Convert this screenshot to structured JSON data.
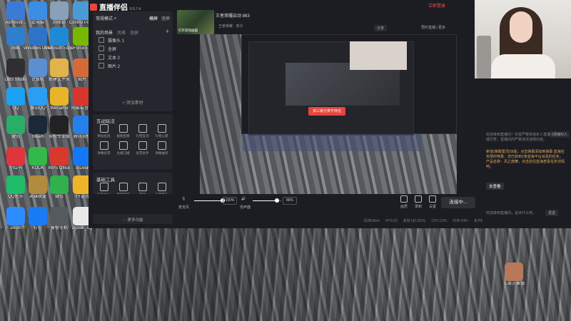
{
  "desktop": {
    "icons": [
      {
        "label": "Administr...",
        "color": "#3b7bd5"
      },
      {
        "label": "此电脑",
        "color": "#3a8ee6"
      },
      {
        "label": "回收站",
        "color": "#8aa0b8"
      },
      {
        "label": "Control Panel",
        "color": "#4a9ad6"
      },
      {
        "label": "网络",
        "color": "#2f7fcf"
      },
      {
        "label": "Windows Defender",
        "color": "#2d74c7"
      },
      {
        "label": "Microsoft Edge",
        "color": "#1e8ad6"
      },
      {
        "label": "GeForce Experience",
        "color": "#76b900"
      },
      {
        "label": "OBS Studio",
        "color": "#302e31"
      },
      {
        "label": "计算机",
        "color": "#5b8fd1"
      },
      {
        "label": "新建文件夹",
        "color": "#e0b44a"
      },
      {
        "label": "图片",
        "color": "#d46a3a"
      },
      {
        "label": "QQ",
        "color": "#1da1f2"
      },
      {
        "label": "腾讯QQ",
        "color": "#2a9df4"
      },
      {
        "label": "WeGame",
        "color": "#e8b52a"
      },
      {
        "label": "网易云音乐",
        "color": "#d8362d"
      },
      {
        "label": "微信",
        "color": "#2aae67"
      },
      {
        "label": "Steam",
        "color": "#1b2838"
      },
      {
        "label": "剪映专业版",
        "color": "#222222"
      },
      {
        "label": "腾讯视频",
        "color": "#2680eb"
      },
      {
        "label": "小红书",
        "color": "#e0353a"
      },
      {
        "label": "KOOK",
        "color": "#33b84a"
      },
      {
        "label": "WPS Office",
        "color": "#d9382d"
      },
      {
        "label": "ToDesk",
        "color": "#1477f8"
      },
      {
        "label": "QQ音乐",
        "color": "#1fbd6a"
      },
      {
        "label": "英雄联盟",
        "color": "#b38b3c"
      },
      {
        "label": "微信",
        "color": "#31b04e"
      },
      {
        "label": "YY语音",
        "color": "#f0b42a"
      },
      {
        "label": "Zoom",
        "color": "#2d8cff"
      },
      {
        "label": "钉钉",
        "color": "#1a7cf5"
      },
      {
        "label": "备份手机",
        "color": "#555a60"
      },
      {
        "label": "2gsldk_log",
        "color": "#e9e9e9"
      }
    ],
    "right_icon": {
      "label": "三周万象镇",
      "color": "#b8785a"
    }
  },
  "app": {
    "title": "直播伴侣",
    "version": "6.5.7.4",
    "login": "立即登录",
    "mode_select": "常规模式 ˅",
    "mode_tabs": [
      "横屏",
      "竖屏"
    ],
    "scene_tabs": [
      "我的场景",
      "风格",
      "竖屏"
    ],
    "sources": [
      "摄像头 1",
      "全屏",
      "文本 2",
      "图片 2"
    ],
    "add_material": "+ 添加素材",
    "interact_title": "互动玩法",
    "interact_items": [
      "精准投放",
      "截图直播",
      "礼物互动",
      "礼物心愿",
      "弹幕投票",
      "主播口播",
      "投票助手",
      "弹幕抽奖"
    ],
    "tools_title": "基础工具",
    "tools_items": [
      "任务中心",
      "直播监控",
      "音效",
      "正版音乐",
      "弹幕库",
      "录屏助手",
      "视频剪辑",
      "下播复盘"
    ],
    "more_func": "··· 更多功能",
    "room_title": "王者荣耀启动 863",
    "room_sub_items": [
      "王者荣耀",
      "高分"
    ],
    "top_game_label": "打开游戏画面",
    "share": "分享",
    "top_menu": "预约直播 | 更多",
    "toast": "该三级分类不存在",
    "mic_label": "麦克风",
    "mic_value": "100%",
    "mic_level": 1.0,
    "speaker_label": "扬声器",
    "speaker_value": "86%",
    "speaker_level": 0.86,
    "right_buttons": [
      "画质",
      "录制",
      "设置"
    ],
    "live_button": "连接中...",
    "status": [
      "码率0kb/s",
      "FPS:60",
      "丢帧 0(0.00%)",
      "CPU:19%",
      "内存:54%",
      "未开播"
    ]
  },
  "chat": {
    "online": "0贡献/0人",
    "notice": "欢迎来到直播间！抖音严禁未成年人直播或打赏，直播间内严禁违法违规内容。",
    "message": "新增(弹幕置顶)功能，点击弹幕添加到弹幕 蓝海任务限时特惠：您已收到1条蓝海平台派发的任务，产品名称：风之旅舞，点击前往蓝海查看任务详情吧。",
    "link": "去查看",
    "bottom": "欢迎来到直播间，说点什么吧...",
    "send": "发送"
  }
}
